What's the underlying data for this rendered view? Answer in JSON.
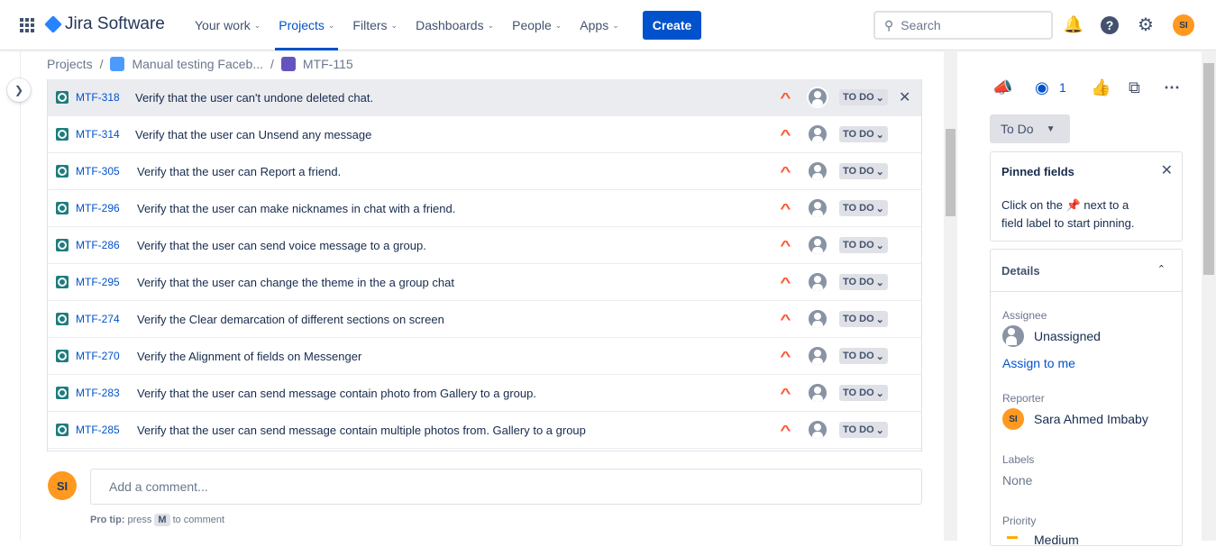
{
  "nav": {
    "brand": "Jira Software",
    "menu": [
      {
        "label": "Your work",
        "active": false
      },
      {
        "label": "Projects",
        "active": true
      },
      {
        "label": "Filters",
        "active": false
      },
      {
        "label": "Dashboards",
        "active": false
      },
      {
        "label": "People",
        "active": false
      },
      {
        "label": "Apps",
        "active": false
      }
    ],
    "create": "Create",
    "search_placeholder": "Search",
    "user_initials": "SI"
  },
  "breadcrumb": {
    "root": "Projects",
    "project": "Manual testing Faceb...",
    "issue": "MTF-115"
  },
  "issues": [
    {
      "key": "MTF-318",
      "summary": "Verify that the user can't undone deleted chat.",
      "status": "TO DO",
      "selected": true
    },
    {
      "key": "MTF-314",
      "summary": "Verify that the user can Unsend any message",
      "status": "TO DO"
    },
    {
      "key": "MTF-305",
      "summary": "Verify that the user can Report a friend.",
      "status": "TO DO"
    },
    {
      "key": "MTF-296",
      "summary": "Verify that the user can make nicknames in chat with a friend.",
      "status": "TO DO"
    },
    {
      "key": "MTF-286",
      "summary": "Verify that the user can send voice message to a group.",
      "status": "TO DO"
    },
    {
      "key": "MTF-295",
      "summary": "Verify that the user can change the theme in the a group chat",
      "status": "TO DO"
    },
    {
      "key": "MTF-274",
      "summary": "Verify the Clear demarcation of different sections on screen",
      "status": "TO DO"
    },
    {
      "key": "MTF-270",
      "summary": "Verify the Alignment of fields on Messenger",
      "status": "TO DO"
    },
    {
      "key": "MTF-283",
      "summary": "Verify that the user can send message contain photo from Gallery to a group.",
      "status": "TO DO"
    },
    {
      "key": "MTF-285",
      "summary": "Verify that the user can send message contain multiple photos from. Gallery to a group",
      "status": "TO DO"
    }
  ],
  "comment": {
    "initials": "SI",
    "placeholder": "Add a comment...",
    "tip_bold": "Pro tip:",
    "tip_press": "press",
    "tip_key": "M",
    "tip_rest": "to comment"
  },
  "side": {
    "watchers": "1",
    "status": "To Do",
    "pinned": {
      "title": "Pinned fields",
      "text1": "Click on the",
      "text2": "next to a",
      "text3": "field label to start pinning."
    },
    "details": {
      "title": "Details",
      "assignee_label": "Assignee",
      "assignee": "Unassigned",
      "assign_me": "Assign to me",
      "reporter_label": "Reporter",
      "reporter_initials": "SI",
      "reporter": "Sara Ahmed Imbaby",
      "labels_label": "Labels",
      "labels": "None",
      "priority_label": "Priority",
      "priority": "Medium"
    }
  },
  "colors": {
    "accent": "#0052cc",
    "priority_high": "#ff5630",
    "avatar": "#ff991f",
    "issue_type": "#1f7d7d"
  }
}
